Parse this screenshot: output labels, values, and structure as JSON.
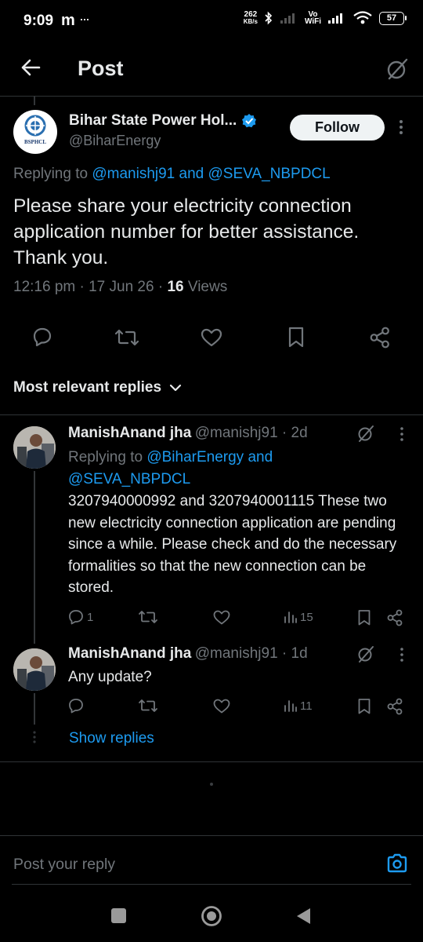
{
  "status_bar": {
    "time": "9:09",
    "carrier_glyph": "m",
    "dots": "···",
    "speed_top": "262",
    "speed_bottom": "KB/s",
    "vo_top": "Vo",
    "vo_bottom": "WiFi",
    "battery": "57"
  },
  "header": {
    "title": "Post"
  },
  "post": {
    "author_name": "Bihar State Power Hol...",
    "author_handle": "@BiharEnergy",
    "avatar_text": "BSPHCL",
    "follow_label": "Follow",
    "replying_prefix": "Replying to ",
    "replying_users": "@manishj91 and @SEVA_NBPDCL",
    "text": "Please share your electricity connection application number for better assistance. Thank you.",
    "time": "12:16 pm · 17 Jun 26 · ",
    "views_count": "16",
    "views_label": " Views"
  },
  "sort": {
    "label": "Most relevant replies"
  },
  "replies": [
    {
      "name": "ManishAnand jha",
      "handle_time": "@manishj91 · 2d",
      "replying_prefix": "Replying to ",
      "replying_line1": "@BiharEnergy and",
      "replying_line2": "@SEVA_NBPDCL",
      "text": "3207940000992 and 3207940001115 These two new electricity connection application are pending since a while. Please check and do the necessary formalities so that the new connection can be stored.",
      "reply_count": "1",
      "views": "15"
    },
    {
      "name": "ManishAnand jha",
      "handle_time": "@manishj91 · 1d",
      "text": "Any update?",
      "views": "11"
    }
  ],
  "show_replies": "Show replies",
  "compose": {
    "placeholder": "Post your reply"
  },
  "colors": {
    "accent": "#1d9bf0",
    "background": "#000000",
    "secondary_text": "#71767b",
    "verified": "#1d9bf0"
  }
}
